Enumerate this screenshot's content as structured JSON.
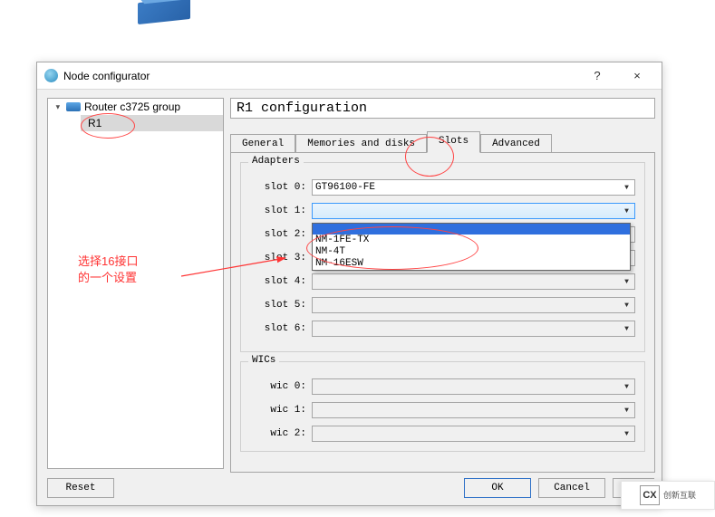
{
  "window": {
    "title": "Node configurator",
    "help": "?",
    "close": "×"
  },
  "tree": {
    "group": "Router c3725 group",
    "leaf": "R1"
  },
  "config_title": "R1 configuration",
  "tabs": {
    "general": "General",
    "memories": "Memories and disks",
    "slots": "Slots",
    "advanced": "Advanced"
  },
  "adapters": {
    "legend": "Adapters",
    "slot0_label": "slot 0:",
    "slot0_value": "GT96100-FE",
    "slot1_label": "slot 1:",
    "slot1_value": "",
    "slot2_label": "slot 2:",
    "slot3_label": "slot 3:",
    "slot4_label": "slot 4:",
    "slot5_label": "slot 5:",
    "slot6_label": "slot 6:"
  },
  "dropdown_options": {
    "opt1": "NM-1FE-TX",
    "opt2": "NM-4T",
    "opt3": "NM-16ESW"
  },
  "wics": {
    "legend": "WICs",
    "wic0_label": "wic 0:",
    "wic1_label": "wic 1:",
    "wic2_label": "wic 2:"
  },
  "buttons": {
    "reset": "Reset",
    "ok": "OK",
    "cancel": "Cancel",
    "apply": "Appl"
  },
  "annotation": {
    "line1": "选择16接口",
    "line2": "的一个设置"
  },
  "watermark": {
    "logo": "CX",
    "text": "创新互联"
  }
}
